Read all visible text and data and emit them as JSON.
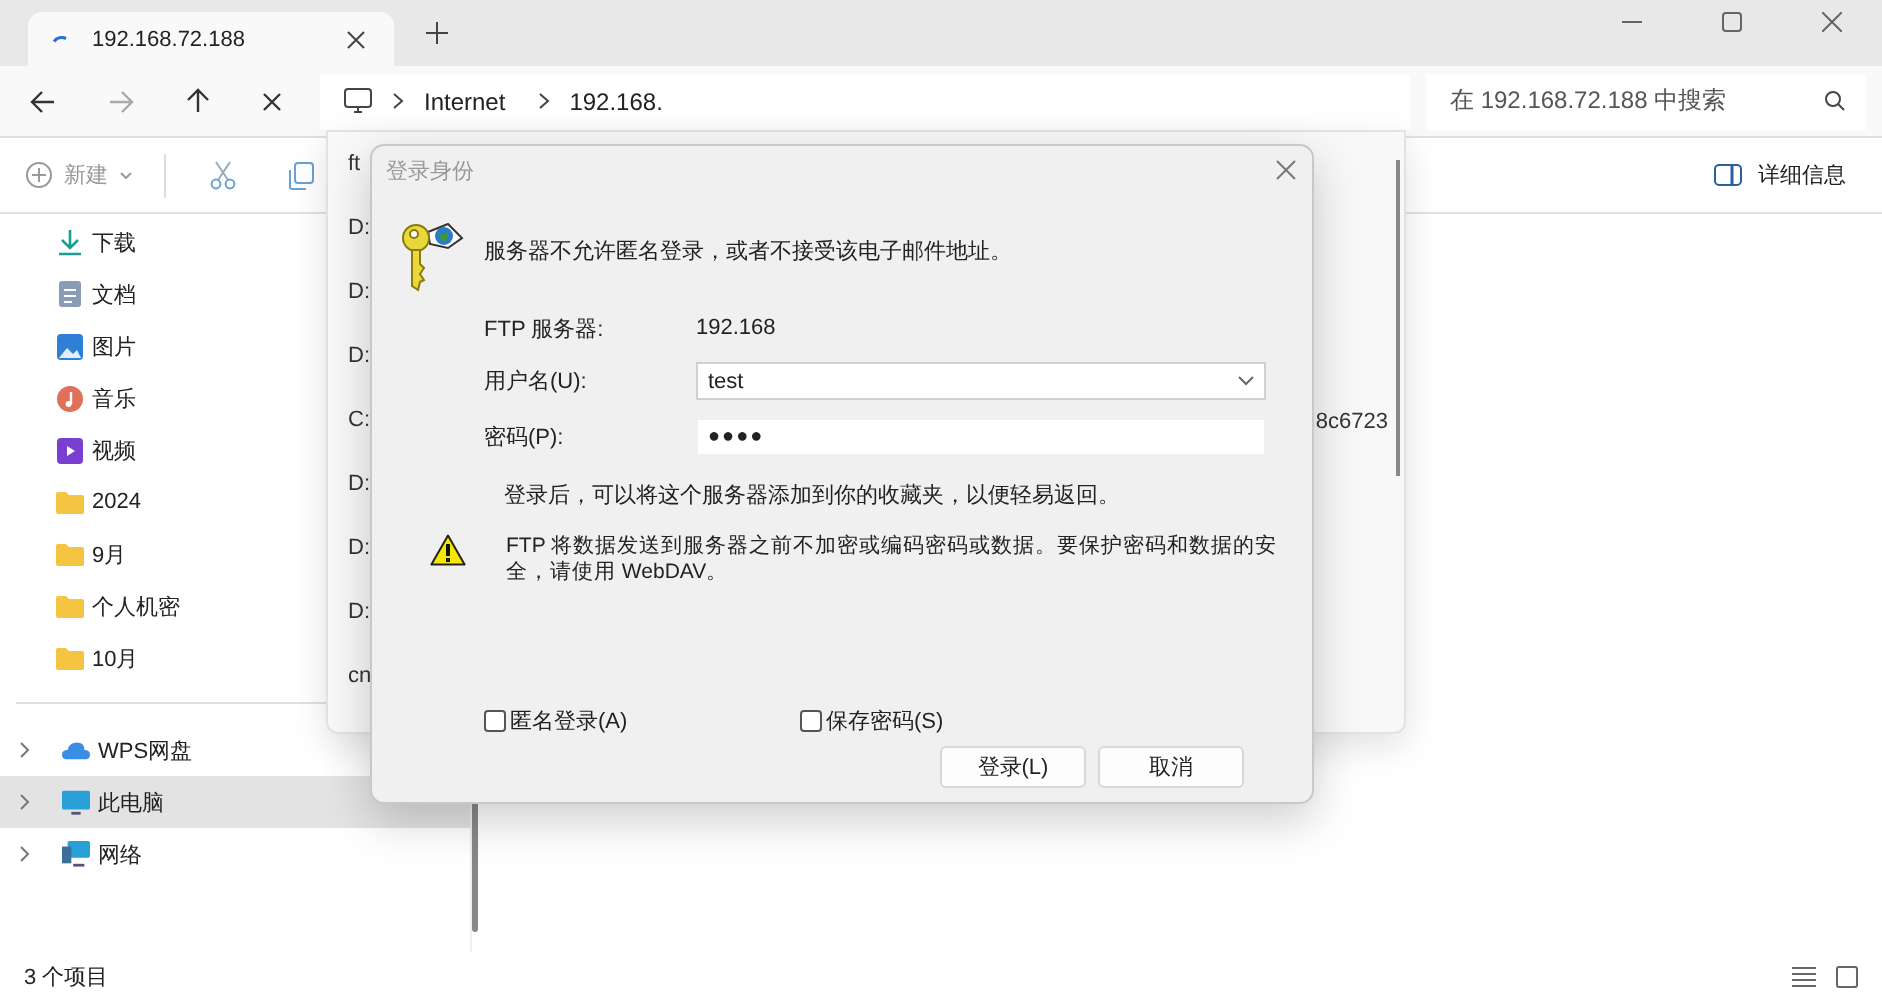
{
  "browser_tab": {
    "title": "192.168.72.188"
  },
  "address": {
    "segments": [
      "Internet",
      "192.168."
    ]
  },
  "search": {
    "placeholder": "在 192.168.72.188 中搜索"
  },
  "toolbar": {
    "new_label": "新建",
    "details_label": "详细信息"
  },
  "sidebar": {
    "items": [
      {
        "label": "下载",
        "kind": "download",
        "selected": false
      },
      {
        "label": "文档",
        "kind": "documents",
        "selected": false
      },
      {
        "label": "图片",
        "kind": "pictures",
        "selected": false
      },
      {
        "label": "音乐",
        "kind": "music",
        "selected": false
      },
      {
        "label": "视频",
        "kind": "videos",
        "selected": false
      },
      {
        "label": "2024",
        "kind": "folder",
        "selected": false
      },
      {
        "label": "9月",
        "kind": "folder",
        "selected": false
      },
      {
        "label": "个人机密",
        "kind": "folder",
        "selected": false
      },
      {
        "label": "10月",
        "kind": "folder",
        "selected": false
      }
    ],
    "locations": [
      {
        "label": "WPS网盘",
        "kind": "cloud",
        "selected": false
      },
      {
        "label": "此电脑",
        "kind": "pc",
        "selected": true
      },
      {
        "label": "网络",
        "kind": "network",
        "selected": false
      }
    ]
  },
  "history_popup": {
    "lines": [
      "ft",
      "D:",
      "D:",
      "D:",
      "C:",
      "D:",
      "D:",
      "D:",
      "cn"
    ],
    "fragment": "8c6723"
  },
  "dialog": {
    "title": "登录身份",
    "message": "服务器不允许匿名登录，或者不接受该电子邮件地址。",
    "server_label": "FTP 服务器:",
    "server_value": "192.168",
    "username_label": "用户名(U):",
    "username_value": "test",
    "password_label": "密码(P):",
    "password_value": "●●●●",
    "info": "登录后，可以将这个服务器添加到你的收藏夹，以便轻易返回。",
    "warning": "FTP 将数据发送到服务器之前不加密或编码密码或数据。要保护密码和数据的安全，请使用 WebDAV。",
    "checkboxes": [
      {
        "label": "匿名登录(A)",
        "checked": false
      },
      {
        "label": "保存密码(S)",
        "checked": false
      }
    ],
    "buttons": [
      "登录(L)",
      "取消"
    ]
  },
  "status_bar": {
    "text": "3 个项目"
  }
}
